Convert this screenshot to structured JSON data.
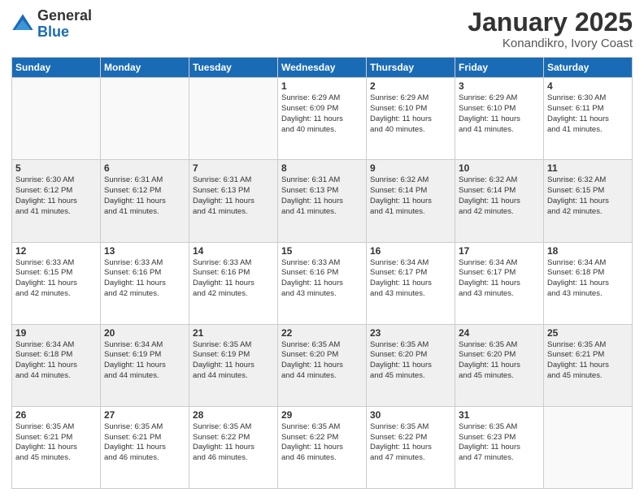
{
  "logo": {
    "general": "General",
    "blue": "Blue"
  },
  "header": {
    "month": "January 2025",
    "location": "Konandikro, Ivory Coast"
  },
  "weekdays": [
    "Sunday",
    "Monday",
    "Tuesday",
    "Wednesday",
    "Thursday",
    "Friday",
    "Saturday"
  ],
  "weeks": [
    [
      {
        "day": "",
        "info": ""
      },
      {
        "day": "",
        "info": ""
      },
      {
        "day": "",
        "info": ""
      },
      {
        "day": "1",
        "info": "Sunrise: 6:29 AM\nSunset: 6:09 PM\nDaylight: 11 hours\nand 40 minutes."
      },
      {
        "day": "2",
        "info": "Sunrise: 6:29 AM\nSunset: 6:10 PM\nDaylight: 11 hours\nand 40 minutes."
      },
      {
        "day": "3",
        "info": "Sunrise: 6:29 AM\nSunset: 6:10 PM\nDaylight: 11 hours\nand 41 minutes."
      },
      {
        "day": "4",
        "info": "Sunrise: 6:30 AM\nSunset: 6:11 PM\nDaylight: 11 hours\nand 41 minutes."
      }
    ],
    [
      {
        "day": "5",
        "info": "Sunrise: 6:30 AM\nSunset: 6:12 PM\nDaylight: 11 hours\nand 41 minutes."
      },
      {
        "day": "6",
        "info": "Sunrise: 6:31 AM\nSunset: 6:12 PM\nDaylight: 11 hours\nand 41 minutes."
      },
      {
        "day": "7",
        "info": "Sunrise: 6:31 AM\nSunset: 6:13 PM\nDaylight: 11 hours\nand 41 minutes."
      },
      {
        "day": "8",
        "info": "Sunrise: 6:31 AM\nSunset: 6:13 PM\nDaylight: 11 hours\nand 41 minutes."
      },
      {
        "day": "9",
        "info": "Sunrise: 6:32 AM\nSunset: 6:14 PM\nDaylight: 11 hours\nand 41 minutes."
      },
      {
        "day": "10",
        "info": "Sunrise: 6:32 AM\nSunset: 6:14 PM\nDaylight: 11 hours\nand 42 minutes."
      },
      {
        "day": "11",
        "info": "Sunrise: 6:32 AM\nSunset: 6:15 PM\nDaylight: 11 hours\nand 42 minutes."
      }
    ],
    [
      {
        "day": "12",
        "info": "Sunrise: 6:33 AM\nSunset: 6:15 PM\nDaylight: 11 hours\nand 42 minutes."
      },
      {
        "day": "13",
        "info": "Sunrise: 6:33 AM\nSunset: 6:16 PM\nDaylight: 11 hours\nand 42 minutes."
      },
      {
        "day": "14",
        "info": "Sunrise: 6:33 AM\nSunset: 6:16 PM\nDaylight: 11 hours\nand 42 minutes."
      },
      {
        "day": "15",
        "info": "Sunrise: 6:33 AM\nSunset: 6:16 PM\nDaylight: 11 hours\nand 43 minutes."
      },
      {
        "day": "16",
        "info": "Sunrise: 6:34 AM\nSunset: 6:17 PM\nDaylight: 11 hours\nand 43 minutes."
      },
      {
        "day": "17",
        "info": "Sunrise: 6:34 AM\nSunset: 6:17 PM\nDaylight: 11 hours\nand 43 minutes."
      },
      {
        "day": "18",
        "info": "Sunrise: 6:34 AM\nSunset: 6:18 PM\nDaylight: 11 hours\nand 43 minutes."
      }
    ],
    [
      {
        "day": "19",
        "info": "Sunrise: 6:34 AM\nSunset: 6:18 PM\nDaylight: 11 hours\nand 44 minutes."
      },
      {
        "day": "20",
        "info": "Sunrise: 6:34 AM\nSunset: 6:19 PM\nDaylight: 11 hours\nand 44 minutes."
      },
      {
        "day": "21",
        "info": "Sunrise: 6:35 AM\nSunset: 6:19 PM\nDaylight: 11 hours\nand 44 minutes."
      },
      {
        "day": "22",
        "info": "Sunrise: 6:35 AM\nSunset: 6:20 PM\nDaylight: 11 hours\nand 44 minutes."
      },
      {
        "day": "23",
        "info": "Sunrise: 6:35 AM\nSunset: 6:20 PM\nDaylight: 11 hours\nand 45 minutes."
      },
      {
        "day": "24",
        "info": "Sunrise: 6:35 AM\nSunset: 6:20 PM\nDaylight: 11 hours\nand 45 minutes."
      },
      {
        "day": "25",
        "info": "Sunrise: 6:35 AM\nSunset: 6:21 PM\nDaylight: 11 hours\nand 45 minutes."
      }
    ],
    [
      {
        "day": "26",
        "info": "Sunrise: 6:35 AM\nSunset: 6:21 PM\nDaylight: 11 hours\nand 45 minutes."
      },
      {
        "day": "27",
        "info": "Sunrise: 6:35 AM\nSunset: 6:21 PM\nDaylight: 11 hours\nand 46 minutes."
      },
      {
        "day": "28",
        "info": "Sunrise: 6:35 AM\nSunset: 6:22 PM\nDaylight: 11 hours\nand 46 minutes."
      },
      {
        "day": "29",
        "info": "Sunrise: 6:35 AM\nSunset: 6:22 PM\nDaylight: 11 hours\nand 46 minutes."
      },
      {
        "day": "30",
        "info": "Sunrise: 6:35 AM\nSunset: 6:22 PM\nDaylight: 11 hours\nand 47 minutes."
      },
      {
        "day": "31",
        "info": "Sunrise: 6:35 AM\nSunset: 6:23 PM\nDaylight: 11 hours\nand 47 minutes."
      },
      {
        "day": "",
        "info": ""
      }
    ]
  ]
}
